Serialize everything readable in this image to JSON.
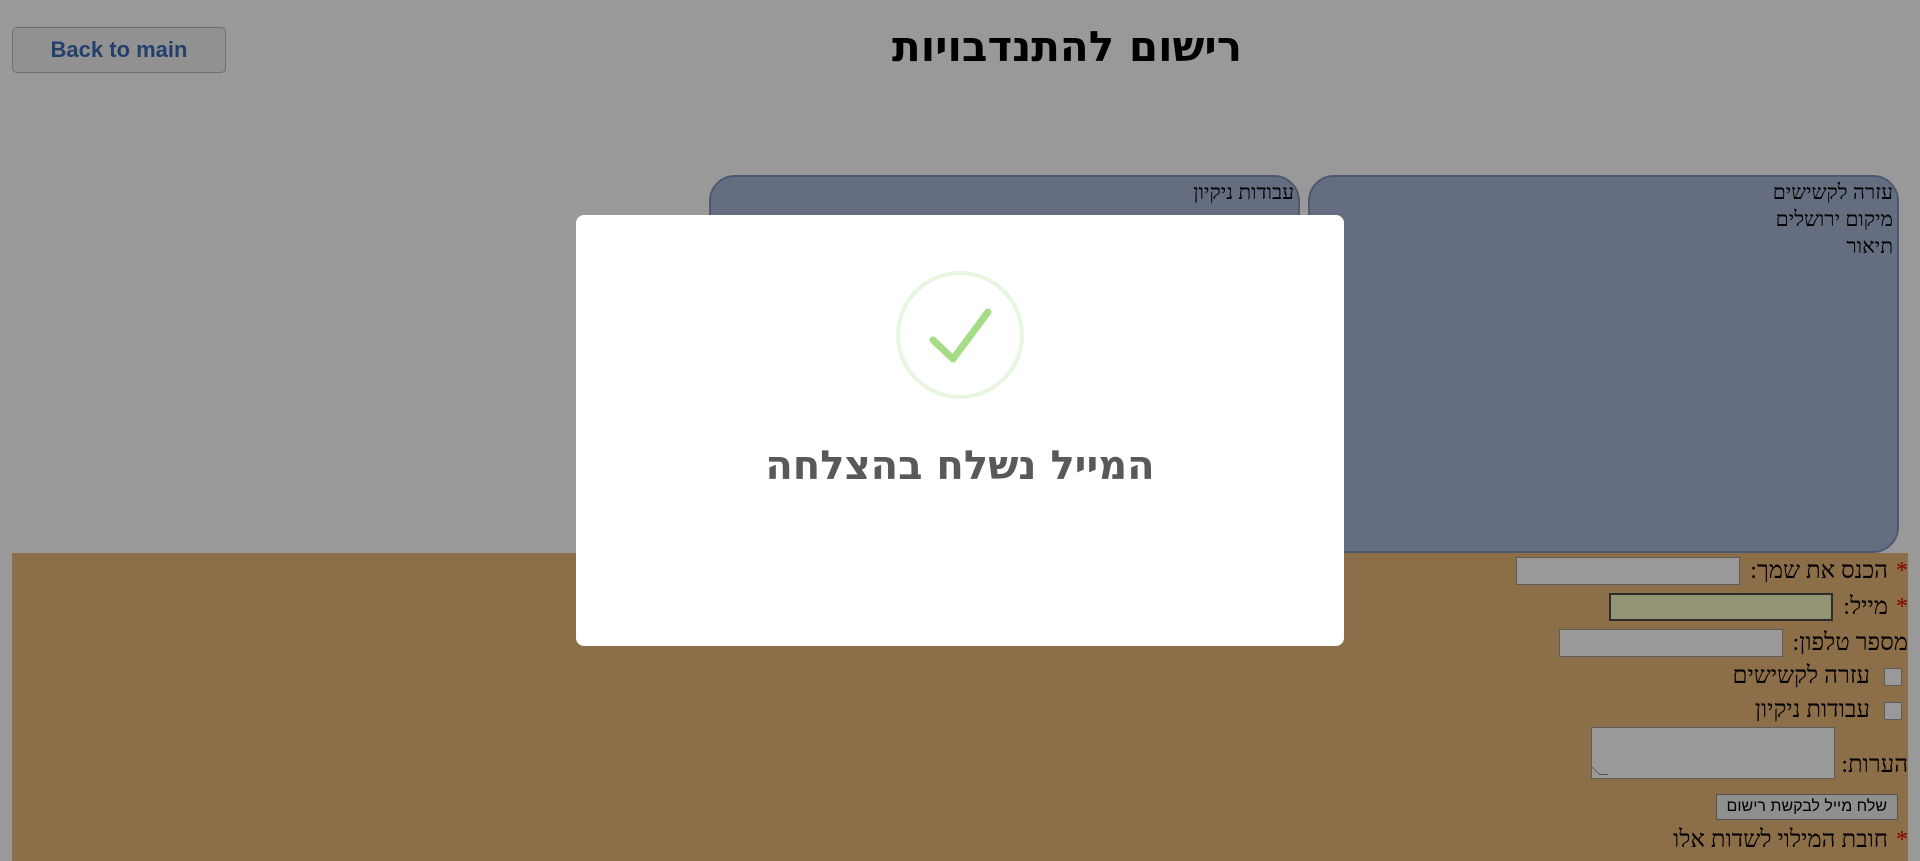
{
  "header": {
    "back_label": "Back to main",
    "title": "רישום להתנדבויות"
  },
  "cards": [
    {
      "lines": [
        "עזרה לקשישים",
        "מיקום ירושלים",
        "תיאור"
      ]
    },
    {
      "lines": [
        "עבודות ניקיון"
      ]
    }
  ],
  "form": {
    "name_label": "הכנס את שמך:",
    "email_label": "מייל:",
    "phone_label": "מספר טלפון:",
    "option_elderly": "עזרה לקשישים",
    "option_cleaning": "עבודות ניקיון",
    "notes_label": "הערות:",
    "submit_label": "שלח מייל לבקשת רישום",
    "required_note": "חובת המילוי לשדות אלו",
    "required_marker": "*"
  },
  "modal": {
    "icon": "success-check-icon",
    "title": "המייל נשלח בהצלחה",
    "accent_color": "#a5dc86"
  }
}
